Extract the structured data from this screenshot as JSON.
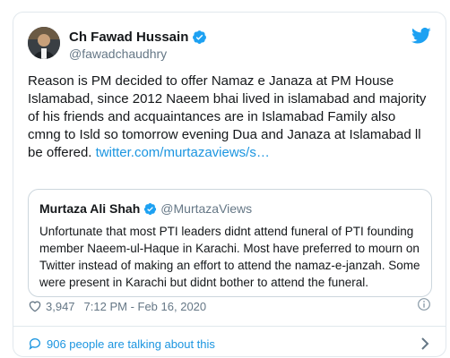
{
  "tweet": {
    "author": {
      "name": "Ch Fawad Hussain",
      "handle": "@fawadchaudhry"
    },
    "text": "Reason is PM decided to offer Namaz e Janaza at PM House Islamabad, since 2012 Naeem bhai lived in islamabad and majority of his friends and acquaintances are in Islamabad Family also cmng to Isld so tomorrow evening Dua and Janaza at Islamabad ll be offered.",
    "link_text": "twitter.com/murtazaviews/s…",
    "quoted": {
      "name": "Murtaza Ali Shah",
      "handle": "@MurtazaViews",
      "text": "Unfortunate that most PTI leaders didnt attend funeral of PTI founding member Naeem-ul-Haque in Karachi. Most have preferred to mourn on Twitter instead of making an effort to attend the namaz-e-janzah. Some were present in Karachi but didnt bother to attend the funeral."
    },
    "likes": "3,947",
    "timestamp": "7:12 PM - Feb 16, 2020",
    "talking": "906 people are talking about this"
  },
  "colors": {
    "accent": "#1b95e0",
    "verified": "#1da1f2",
    "muted": "#657786",
    "border": "#e1e8ed"
  },
  "icons": {
    "verified": "verified-badge-icon",
    "bird": "twitter-bird-icon",
    "heart": "heart-icon",
    "info": "info-icon",
    "bubble": "speech-bubble-icon",
    "chevron": "chevron-right-icon"
  }
}
